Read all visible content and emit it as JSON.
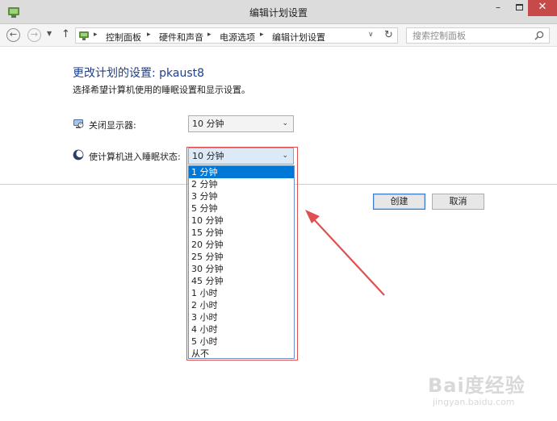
{
  "window": {
    "title": "编辑计划设置",
    "min_label": "–",
    "close_label": "✕"
  },
  "nav": {
    "back_label": "←",
    "forward_label": "→",
    "dropdown_label": "▼",
    "up_label": "↑",
    "breadcrumbs": [
      "控制面板",
      "硬件和声音",
      "电源选项",
      "编辑计划设置"
    ],
    "separator": "▸",
    "address_dropdown": "∨",
    "refresh_label": "↻",
    "search_placeholder": "搜索控制面板"
  },
  "content": {
    "title": "更改计划的设置: pkaust8",
    "subtitle": "选择希望计算机使用的睡眠设置和显示设置。",
    "display_off": {
      "label": "关闭显示器:",
      "value": "10 分钟",
      "icon": "monitor-clock-icon"
    },
    "sleep": {
      "label": "使计算机进入睡眠状态:",
      "value": "10 分钟",
      "icon": "moon-icon",
      "options": [
        "1 分钟",
        "2 分钟",
        "3 分钟",
        "5 分钟",
        "10 分钟",
        "15 分钟",
        "20 分钟",
        "25 分钟",
        "30 分钟",
        "45 分钟",
        "1 小时",
        "2 小时",
        "3 小时",
        "4 小时",
        "5 小时",
        "从不"
      ],
      "highlighted_option": "1 分钟"
    },
    "chevron": "⌄",
    "create_label": "创建",
    "cancel_label": "取消"
  },
  "watermark": {
    "logo": "Bai度经验",
    "url": "jingyan.baidu.com"
  },
  "colors": {
    "title_blue": "#1e3f8c",
    "selection": "#0078d7",
    "annotation_red": "#e05050",
    "close_button": "#c74a4a"
  }
}
